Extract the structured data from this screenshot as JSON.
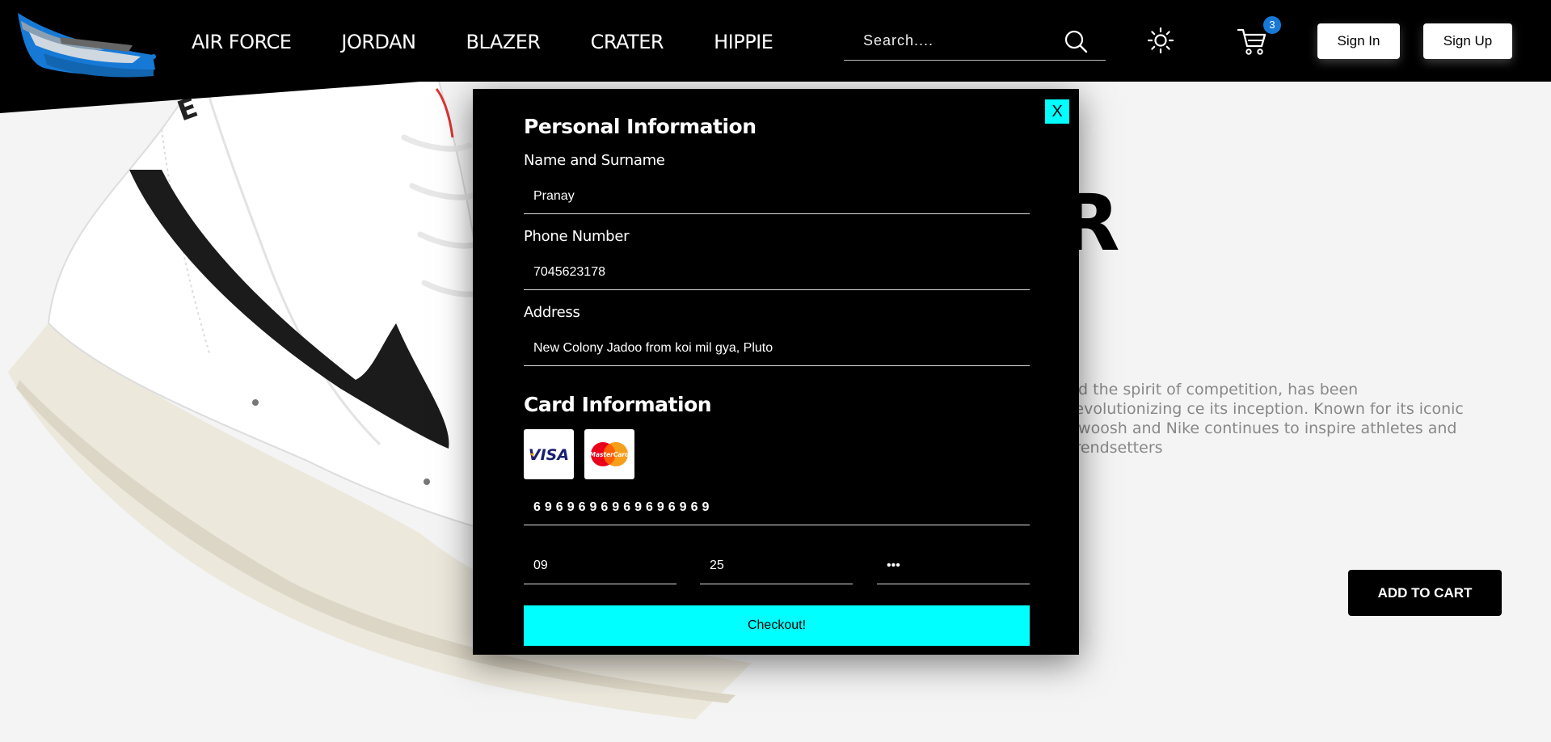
{
  "nav": {
    "links": [
      "AIR FORCE",
      "JORDAN",
      "BLAZER",
      "CRATER",
      "HIPPIE"
    ],
    "search_placeholder": "Search....",
    "cart_count": "3",
    "signin_label": "Sign In",
    "signup_label": "Sign Up"
  },
  "product": {
    "title_fragment": "ER",
    "description": "nd the spirit of competition, has been revolutionizing ce its inception. Known for its iconic Swoosh and Nike continues to inspire athletes and trendsetters",
    "add_to_cart_label": "ADD TO CART"
  },
  "modal": {
    "close_label": "X",
    "personal_heading": "Personal Information",
    "name_label": "Name and Surname",
    "name_value": "Pranay",
    "phone_label": "Phone Number",
    "phone_value": "7045623178",
    "address_label": "Address",
    "address_value": "New Colony Jadoo from koi mil gya, Pluto",
    "card_heading": "Card Information",
    "card_logos": [
      "VISA",
      "MasterCard"
    ],
    "card_number": "6969696969696969",
    "exp_month": "09",
    "exp_year": "25",
    "cvv": "•••",
    "checkout_label": "Checkout!"
  },
  "colors": {
    "accent": "#00ffff",
    "nav_bg": "#000000",
    "badge": "#1779d6"
  },
  "icons": [
    "shoe-logo-icon",
    "search-icon",
    "sun-icon",
    "cart-icon",
    "visa-icon",
    "mastercard-icon"
  ]
}
